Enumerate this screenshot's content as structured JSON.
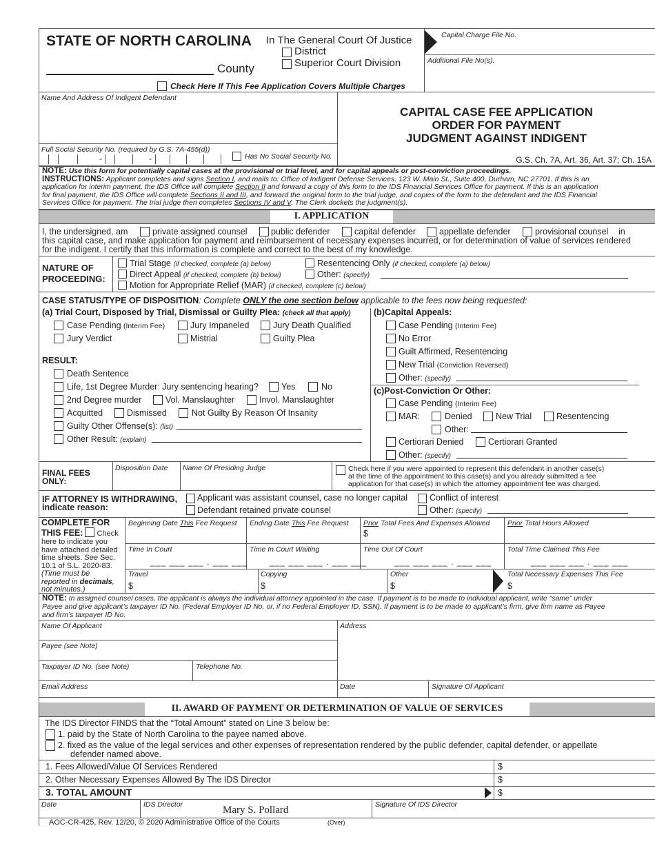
{
  "header": {
    "state": "STATE OF NORTH CAROLINA",
    "court": "In The General Court Of Justice",
    "district": "District",
    "superior": "Superior Court Division",
    "county": "County",
    "multiple_charges": "Check Here If This Fee Application Covers Multiple Charges",
    "capital_file_no": "Capital Charge File No.",
    "additional_file_no": "Additional File No(s)."
  },
  "defendant": {
    "name_address_label": "Name And Address Of Indigent Defendant",
    "ssn_label": "Full Social Security No. (required by G.S. 7A-455(d))",
    "no_ssn": "Has No Social Security No."
  },
  "title": {
    "line1": "CAPITAL CASE FEE APPLICATION",
    "line2": "ORDER FOR PAYMENT",
    "line3": "JUDGMENT AGAINST INDIGENT",
    "statute": "G.S. Ch. 7A, Art. 36, Art. 37; Ch. 15A"
  },
  "note": {
    "note_head": "NOTE:",
    "note_text": "Use this form for potentially capital cases at the provisional or trial level, and for capital appeals or post-conviction proceedings.",
    "instr_head": "INSTRUCTIONS:",
    "instr_1": "Applicant completes and signs",
    "instr_sec1": "Section I",
    "instr_2": ", and mails to: Office of Indigent Defense Services, 123 W. Main St., Suite 400, Durham, NC 27701. If this is an",
    "instr_3": "application for interim payment, the IDS Office will complete",
    "instr_sec2": "Section II",
    "instr_4": "and forward a copy of this form to the IDS Financial Services Office for payment. If this is an application",
    "instr_5": "for final payment, the IDS Office will complete",
    "instr_sec23": "Sections II and III",
    "instr_6": ", and forward the original form to the trial judge, and copies of the form to the defendant and the IDS Financial",
    "instr_7": "Services Office for payment. The trial judge then completes",
    "instr_sec45": "Sections IV and V",
    "instr_8": ". The Clerk dockets the judgment(s)."
  },
  "section1": {
    "title": "I. APPLICATION",
    "undersigned": "I, the undersigned, am",
    "roles": [
      "private assigned counsel",
      "public defender",
      "capital defender",
      "appellate defender",
      "provisional counsel"
    ],
    "in": "in",
    "cert_1": "this capital case, and make application for payment and reimbursement of necessary expenses incurred, or for determination of value of services rendered",
    "cert_2": "for the indigent. I certify that this information is complete and correct to the best of my knowledge."
  },
  "nature": {
    "label_1": "NATURE OF",
    "label_2": "PROCEEDING:",
    "trial": "Trial Stage",
    "trial_note": "(if checked, complete (a) below)",
    "resent": "Resentencing Only",
    "resent_note": "(if checked, complete (a) below)",
    "direct": "Direct Appeal",
    "direct_note": "(if checked, complete (b) below)",
    "other": "Other:",
    "other_note": "(specify)",
    "mar": "Motion for Appropriate Relief (MAR)",
    "mar_note": "(if checked, complete (c) below)"
  },
  "case_status": {
    "head": "CASE STATUS/TYPE OF DISPOSITION",
    "instr_1": ": Complete ",
    "instr_only": "ONLY the one section below",
    "instr_2": " applicable to the fees now being requested:",
    "a_head": "(a) Trial Court, Disposed by Trial, Dismissal or Guilty Plea:",
    "a_note": "(check all that apply)",
    "case_pending": "Case Pending",
    "interim": "(Interim Fee)",
    "jury_impaneled": "Jury Impaneled",
    "jury_death": "Jury Death Qualified",
    "jury_verdict": "Jury Verdict",
    "mistrial": "Mistrial",
    "guilty_plea": "Guilty Plea",
    "result": "RESULT:",
    "death": "Death Sentence",
    "life": "Life, 1st Degree Murder: Jury sentencing hearing?",
    "yes": "Yes",
    "no": "No",
    "second": "2nd Degree murder",
    "vol": "Vol. Manslaughter",
    "invol": "Invol. Manslaughter",
    "acquitted": "Acquitted",
    "dismissed": "Dismissed",
    "ngri": "Not Guilty By Reason Of Insanity",
    "guilty_other": "Guilty Other Offense(s):",
    "list": "(list)",
    "other_result": "Other Result:",
    "explain": "(explain)",
    "b_label": "(b)",
    "b_head": "Capital Appeals:",
    "b_pending": "Case Pending",
    "b_no_error": "No Error",
    "b_guilt": "Guilt Affirmed, Resentencing",
    "b_new_trial": "New Trial",
    "b_reversed": "(Conviction Reversed)",
    "b_other": "Other:",
    "specify": "(specify)",
    "c_label": "(c)",
    "c_head": "Post-Conviction Or Other:",
    "c_pending": "Case Pending",
    "c_mar": "MAR:",
    "c_denied": "Denied",
    "c_new_trial": "New Trial",
    "c_resent": "Resentencing",
    "c_mar_other": "Other:",
    "c_cert_denied": "Certiorari Denied",
    "c_cert_granted": "Certiorari Granted",
    "c_other": "Other:"
  },
  "final_fees": {
    "label_1": "FINAL FEES",
    "label_2": "ONLY:",
    "disposition_date": "Disposition Date",
    "presiding_judge": "Name Of Presiding Judge",
    "check_1": "Check here if you were appointed to represent this defendant in another case(s)",
    "check_2": "at the time of the appointment to this case(s) and you already submitted a fee",
    "check_3": "application for that case(s) in which the attorney appointment fee was charged."
  },
  "withdrawing": {
    "label_1": "IF ATTORNEY IS WITHDRAWING,",
    "label_2": "indicate reason:",
    "assistant": "Applicant was assistant counsel, case no longer capital",
    "retained": "Defendant retained private counsel",
    "conflict": "Conflict of interest",
    "other": "Other:",
    "specify": "(specify)"
  },
  "fee": {
    "l1": "COMPLETE FOR",
    "l2": "THIS FEE:",
    "l2b": "Check",
    "l3": "here to indicate you",
    "l4": "have attached detailed",
    "l5a": "time sheets.",
    "l5b": "See",
    "l5c": "Sec.",
    "l6": "10.1 of S.L. 2020-83.",
    "l7": "(Time must be",
    "l8a": "reported in ",
    "l8b": "decimals",
    "l8c": ",",
    "l9": "not minutes.)",
    "begin_a": "Beginning Date ",
    "this": "This",
    "begin_b": " Fee Request",
    "end_a": "Ending Date ",
    "end_b": " Fee Request",
    "prior": "Prior",
    "prior_fees": " Total Fees And Expenses Allowed",
    "prior_hours": " Total Hours Allowed",
    "dollar": "$",
    "time_court": "Time In Court",
    "time_waiting": "Time In Court Waiting",
    "time_out": "Time Out Of Court",
    "total_time": "Total Time Claimed This Fee",
    "time_blank": "___ ___ ___ . ___ ___",
    "travel": "Travel",
    "copying": "Copying",
    "other": "Other",
    "total_exp": "Total Necessary Expenses This Fee"
  },
  "payee_note": {
    "head": "NOTE:",
    "l1": "In assigned counsel cases, the applicant is always the individual attorney appointed in the case. If payment is to be made to individual applicant, write “same” under",
    "l2": "Payee and give applicant’s taxpayer ID No. (Federal Employer ID No. or, if no Federal Employer ID, SSN). If payment is to be made to applicant’s firm, give firm name as Payee",
    "l3": "and firm’s taxpayer ID No."
  },
  "applicant": {
    "name": "Name Of Applicant",
    "address": "Address",
    "payee": "Payee (see Note)",
    "taxpayer": "Taxpayer ID No. (see Note)",
    "telephone": "Telephone No.",
    "email": "Email Address",
    "date": "Date",
    "signature": "Signature Of Applicant"
  },
  "section2": {
    "title": "II. AWARD OF PAYMENT OR DETERMINATION OF VALUE OF SERVICES",
    "finds": "The IDS Director FINDS that the “Total Amount” stated on Line 3 below be:",
    "opt1": "1.  paid by the State of North Carolina to the payee named above.",
    "opt2a": "2.  fixed as the value of the legal services and other expenses of representation rendered by the public defender, capital defender, or appellate",
    "opt2b": "defender named above.",
    "line1": "1. Fees Allowed/Value Of Services Rendered",
    "line2": "2. Other Necessary Expenses Allowed By The IDS Director",
    "line3": "3. TOTAL AMOUNT",
    "dollar": "$",
    "date": "Date",
    "director_label": "IDS Director",
    "director_name": "Mary S. Pollard",
    "signature": "Signature Of IDS Director"
  },
  "footer": {
    "form": "AOC-CR-425, Rev. 12/20, © 2020 Administrative Office of the Courts",
    "over": "(Over)"
  }
}
